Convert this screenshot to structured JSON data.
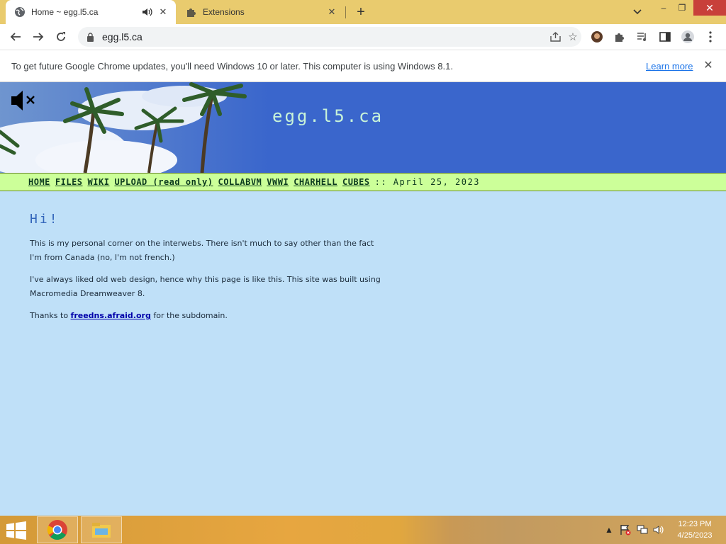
{
  "browser": {
    "tabs": [
      {
        "title": "Home ~ egg.l5.ca",
        "active": true,
        "favicon": "globe-icon",
        "audio": "speaker-icon"
      },
      {
        "title": "Extensions",
        "active": false,
        "favicon": "puzzle-icon"
      }
    ],
    "new_tab_label": "+",
    "url": "egg.l5.ca",
    "window_controls": {
      "minimize": "–",
      "restore": "❐",
      "close": "✕"
    }
  },
  "infobar": {
    "message": "To get future Google Chrome updates, you'll need Windows 10 or later. This computer is using Windows 8.1.",
    "link": "Learn more",
    "close": "✕"
  },
  "site": {
    "title": "egg.l5.ca",
    "nav": [
      "HOME",
      "FILES",
      "WIKI",
      "UPLOAD (read only)",
      "COLLABVM",
      "VWWI",
      "CHARHELL",
      "CUBES"
    ],
    "date": ":: April 25, 2023",
    "heading": "Hi!",
    "paragraph1": "This is my personal corner on the interwebs. There isn't much to say other than the fact I'm from Canada (no, I'm not french.)",
    "paragraph2": "I've always liked old web design, hence why this page is like this. This site was built using Macromedia Dreamweaver 8.",
    "thanks_prefix": "Thanks to ",
    "thanks_link": "freedns.afraid.org",
    "thanks_suffix": " for the subdomain."
  },
  "taskbar": {
    "apps": [
      "chrome-icon",
      "file-explorer-icon"
    ],
    "time": "12:23 PM",
    "date": "4/25/2023"
  },
  "colors": {
    "tab_strip": "#e9cb6e",
    "page_bg": "#bfe0f8",
    "banner_blue": "#3a66cc",
    "nav_green": "#ccff99",
    "close_red": "#c8403a"
  }
}
